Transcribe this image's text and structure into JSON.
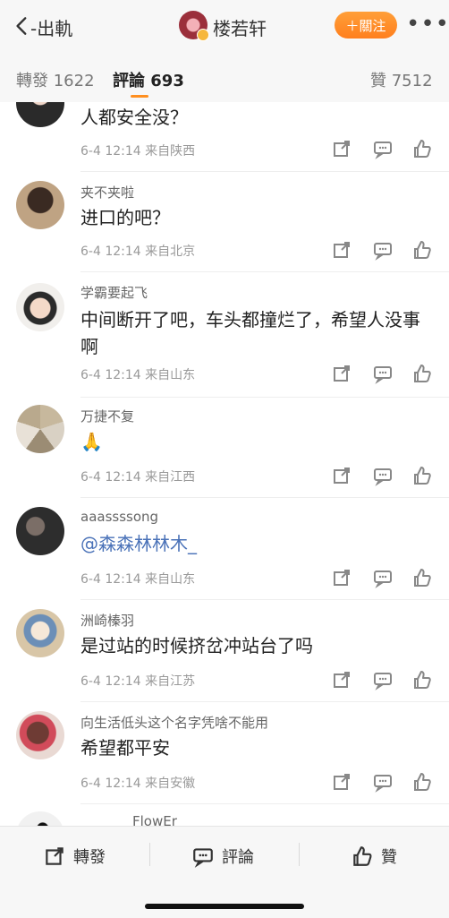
{
  "header": {
    "back_title": "-出軌",
    "user_name": "楼若轩",
    "follow_label": "＋關注",
    "more_label": "•••"
  },
  "tabs": {
    "repost": "轉發 1622",
    "comment": "評論 693",
    "like": "贊 7512"
  },
  "comments": [
    {
      "name": "",
      "text": "人都安全没？",
      "date": "6-4 12:14",
      "from": "来自陕西"
    },
    {
      "name": "夹不夹啦",
      "text": "进口的吧？",
      "date": "6-4 12:14",
      "from": "来自北京"
    },
    {
      "name": "学霸要起飞",
      "text": "中间断开了吧，车头都撞烂了，希望人没事啊",
      "date": "6-4 12:14",
      "from": "来自山东"
    },
    {
      "name": "万捷不复",
      "text": "🙏",
      "date": "6-4 12:14",
      "from": "来自江西"
    },
    {
      "name": "aaassssong",
      "text": "@森森林林木_",
      "date": "6-4 12:14",
      "from": "来自山东"
    },
    {
      "name": "洲崎榛羽",
      "text": "是过站的时候挤岔冲站台了吗",
      "date": "6-4 12:14",
      "from": "来自江苏"
    },
    {
      "name": "向生活低头这个名字凭啥不能用",
      "text": "希望都平安",
      "date": "6-4 12:14",
      "from": "来自安徽"
    },
    {
      "name": "FlowEr",
      "text": "",
      "date": "",
      "from": ""
    }
  ],
  "bottom_bar": {
    "repost": "轉發",
    "comment": "評論",
    "like": "贊"
  },
  "icons": {
    "back": "chevron-left-icon",
    "share": "share-icon",
    "comment": "comment-icon",
    "like": "thumbs-up-icon"
  },
  "colors": {
    "accent": "#ff8f1f",
    "link": "#4a72b8",
    "muted": "#999999"
  }
}
